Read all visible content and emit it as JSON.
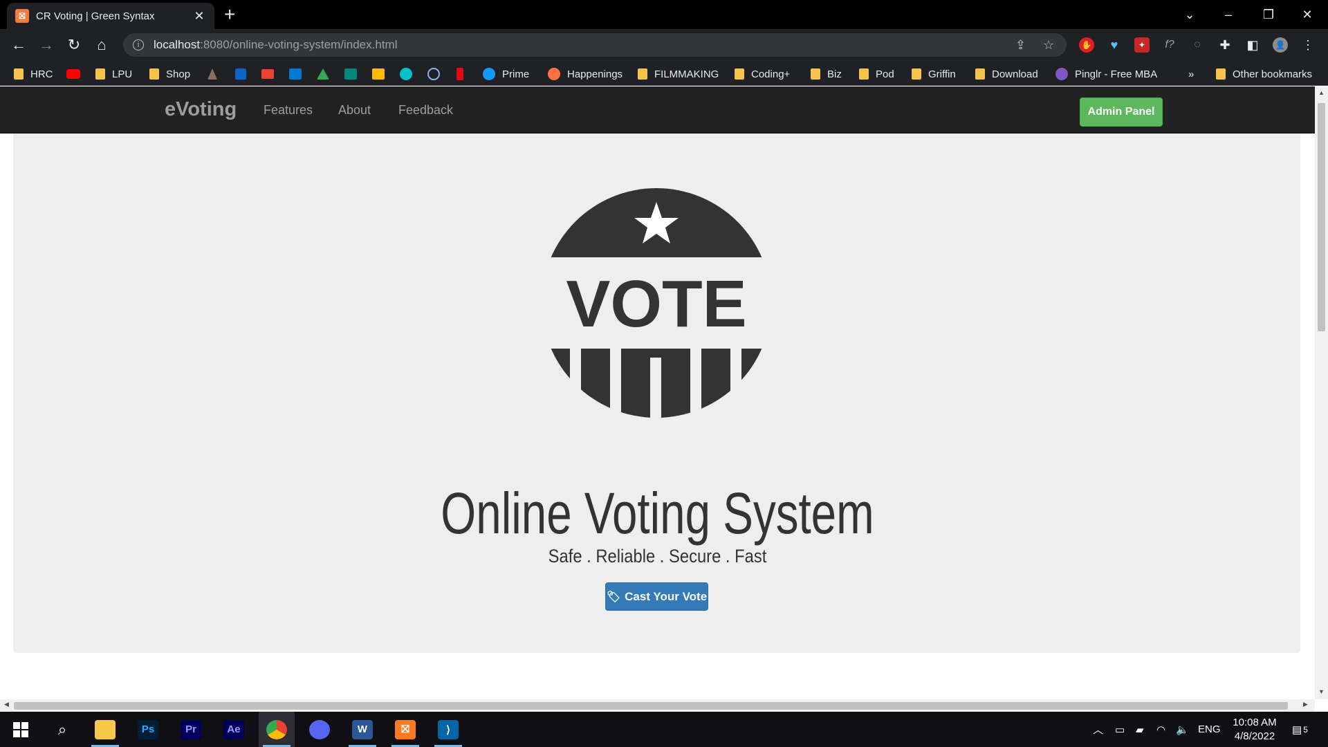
{
  "browser": {
    "tab_title": "CR Voting | Green Syntax",
    "tab_favicon": "XAMPP-icon",
    "url_host": "localhost",
    "url_path": ":8080/online-voting-system/index.html",
    "bookmarks": [
      "HRC",
      "",
      "LPU",
      "Shop",
      "",
      "",
      "",
      "",
      "",
      "",
      "",
      "",
      "",
      "",
      "",
      "Prime",
      "Happenings",
      "FILMMAKING",
      "Coding+",
      "Biz",
      "Pod",
      "Griffin",
      "Download",
      "Pinglr - Free MBA"
    ],
    "bookmarks_overflow": "»",
    "other_bookmarks": "Other bookmarks"
  },
  "site": {
    "brand": "eVoting",
    "nav": [
      "Features",
      "About",
      "Feedback"
    ],
    "admin_button": "Admin Panel"
  },
  "hero": {
    "logo_text": "VOTE",
    "title": "Online Voting System",
    "subtitle": "Safe . Reliable . Secure . Fast",
    "cta": "Cast Your Vote"
  },
  "taskbar": {
    "apps": [
      "start-icon",
      "search-icon",
      "file-explorer-icon",
      "photoshop-icon",
      "premiere-icon",
      "after-effects-icon",
      "chrome-icon",
      "discord-icon",
      "word-icon",
      "xampp-icon",
      "vscode-icon"
    ],
    "app_labels": {
      "photoshop": "Ps",
      "premiere": "Pr",
      "after_effects": "Ae",
      "word": "W"
    },
    "language": "ENG",
    "time": "10:08 AM",
    "date": "4/8/2022",
    "notification_count": "5"
  },
  "colors": {
    "navbar": "#222222",
    "admin_green": "#5cb85c",
    "cast_blue": "#337ab7",
    "jumbotron": "#eeeeee",
    "logo": "#333333"
  }
}
